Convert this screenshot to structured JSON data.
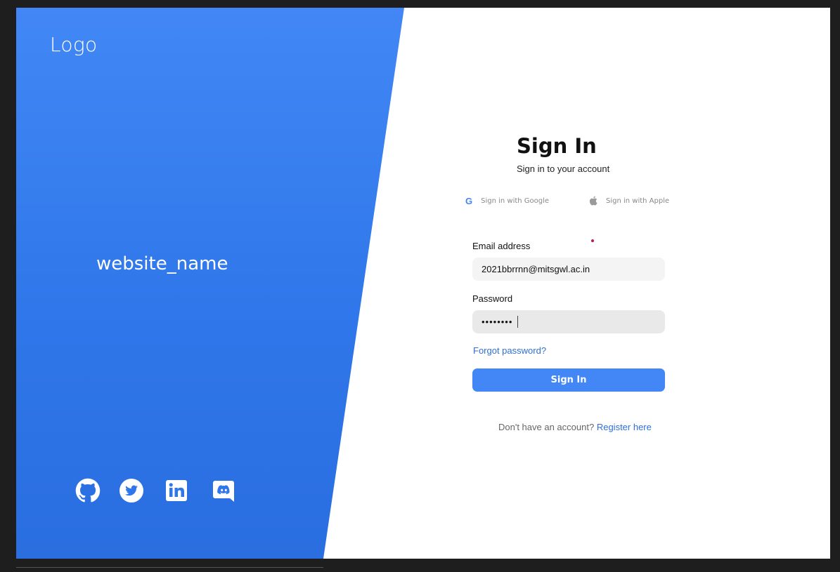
{
  "brand": {
    "logo_text": "Logo",
    "website_name": "website_name"
  },
  "social": [
    {
      "name": "github",
      "icon": "github-icon"
    },
    {
      "name": "twitter",
      "icon": "twitter-icon"
    },
    {
      "name": "linkedin",
      "icon": "linkedin-icon"
    },
    {
      "name": "discord",
      "icon": "discord-icon"
    }
  ],
  "signin": {
    "title": "Sign In",
    "subtitle": "Sign in to your account",
    "google_label": "Sign in with Google",
    "apple_label": "Sign in with Apple",
    "email_label": "Email address",
    "email_value": "2021bbrrnn@mitsgwl.ac.in",
    "password_label": "Password",
    "password_value": "••••••••",
    "forgot_label": "Forgot password?",
    "button_label": "Sign In",
    "no_account_text": "Don't have an account?",
    "register_label": "Register here"
  },
  "colors": {
    "accent": "#4287f5",
    "link": "#2f6fd6",
    "panel": "#2f77ea"
  }
}
